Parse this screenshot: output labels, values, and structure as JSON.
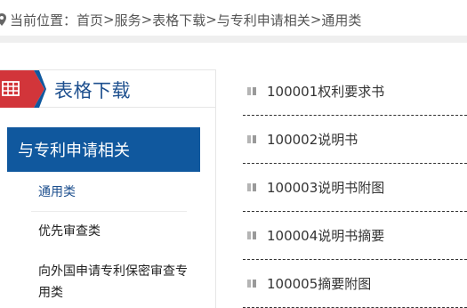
{
  "breadcrumb": {
    "prefix": "当前位置：",
    "sep": ">",
    "items": [
      "首页",
      "服务",
      "表格下载",
      "与专利申请相关",
      "通用类"
    ]
  },
  "sidebar": {
    "title": "表格下载",
    "category": "与专利申请相关",
    "items": [
      {
        "label": "通用类",
        "active": true
      },
      {
        "label": "优先审查类"
      },
      {
        "label": "向外国申请专利保密审查专用类"
      }
    ]
  },
  "files": [
    "100001权利要求书",
    "100002说明书",
    "100003说明书附图",
    "100004说明书摘要",
    "100005摘要附图"
  ],
  "colors": {
    "brand": "#10589e",
    "title": "#1d4f8e",
    "accent_red": "#d2353a"
  }
}
